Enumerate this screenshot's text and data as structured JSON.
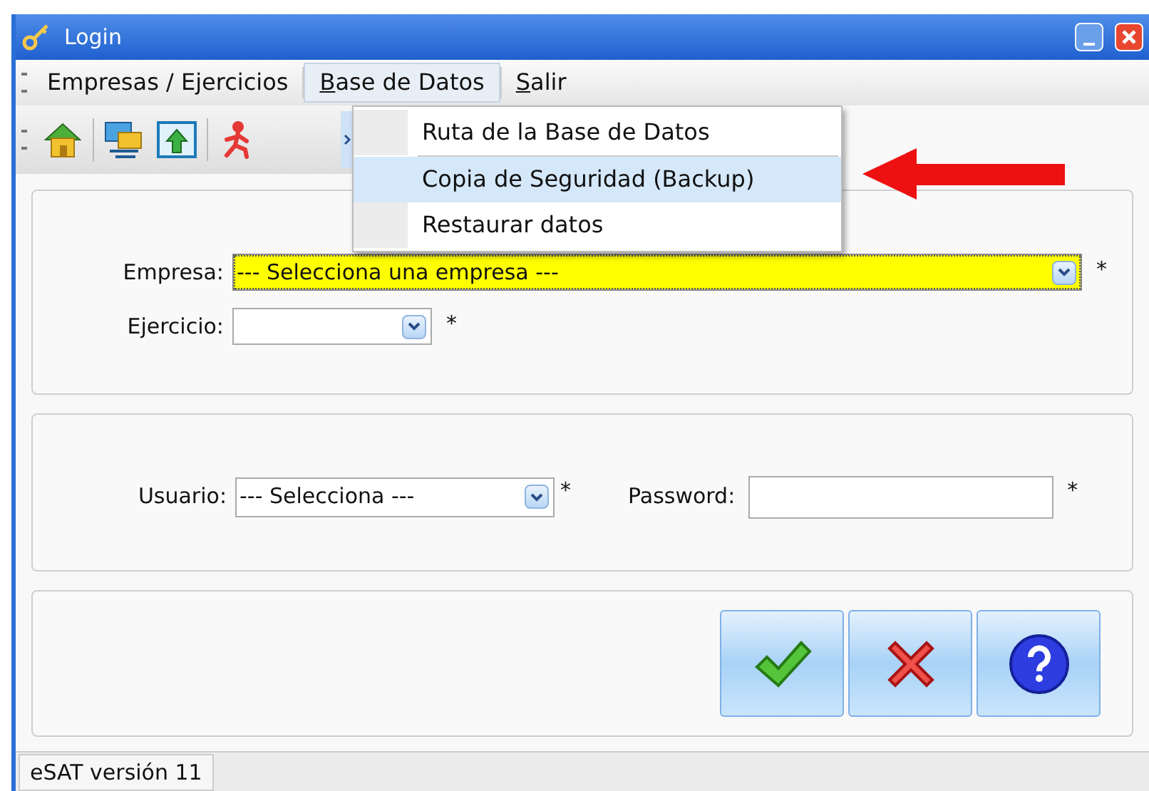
{
  "window": {
    "title": "Login"
  },
  "menu_bar": [
    {
      "label": "Empresas / Ejercicios",
      "access_key": false,
      "selected": false
    },
    {
      "label": "Base de Datos",
      "access_key": true,
      "selected": true
    },
    {
      "label": "Salir",
      "access_key": true,
      "selected": false
    }
  ],
  "toolbar": [
    {
      "kind": "house"
    },
    {
      "kind": "network"
    },
    {
      "kind": "upload"
    },
    {
      "kind": "runner"
    }
  ],
  "dropdown_menu": [
    {
      "label": "Ruta de la Base de Datos",
      "selected": false
    },
    {
      "label": "Copia de Seguridad (Backup)",
      "selected": true
    },
    {
      "label": "Restaurar datos",
      "selected": false
    }
  ],
  "company_panel": {
    "fields": [
      {
        "label": "Empresa:",
        "value": "--- Selecciona una empresa ---",
        "focused": true,
        "required": "*",
        "wide": true
      },
      {
        "label": "Ejercicio:",
        "focused": false,
        "required": "*",
        "wide": false
      }
    ]
  },
  "login_panel": {
    "user": {
      "label": "Usuario:",
      "value": "--- Selecciona ---",
      "required": "*"
    },
    "password": {
      "label": "Password:",
      "required": "*"
    }
  },
  "buttons": [
    {
      "kind": "ok"
    },
    {
      "kind": "cancel"
    },
    {
      "kind": "help"
    }
  ],
  "status_bar": "eSAT versión 11"
}
